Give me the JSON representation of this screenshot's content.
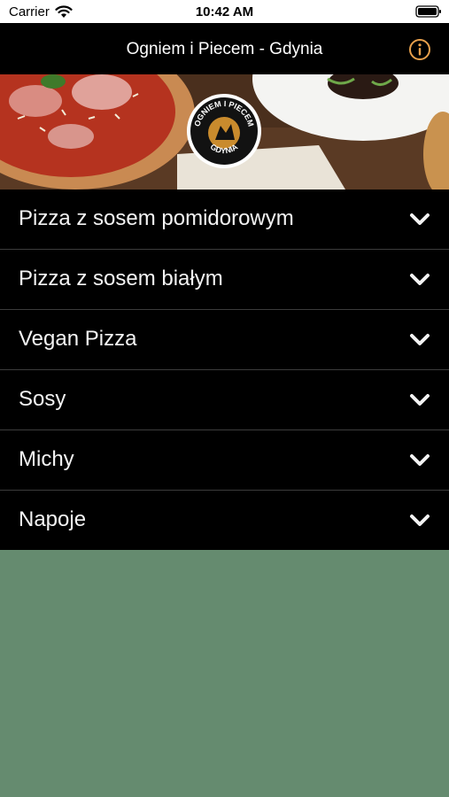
{
  "status_bar": {
    "carrier": "Carrier",
    "time": "10:42 AM",
    "icons": [
      "wifi-icon",
      "battery-icon"
    ]
  },
  "navbar": {
    "title": "Ogniem i Piecem - Gdynia",
    "info_icon": "info-icon",
    "accent_color": "#e8a04c"
  },
  "hero": {
    "logo_text_top": "OGNIEM I PIECEM",
    "logo_text_bottom": "GDYNIA"
  },
  "menu": {
    "items": [
      {
        "label": "Pizza z sosem pomidorowym",
        "icon": "chevron-down-icon"
      },
      {
        "label": "Pizza z sosem białym",
        "icon": "chevron-down-icon"
      },
      {
        "label": "Vegan Pizza",
        "icon": "chevron-down-icon"
      },
      {
        "label": "Sosy",
        "icon": "chevron-down-icon"
      },
      {
        "label": "Michy",
        "icon": "chevron-down-icon"
      },
      {
        "label": "Napoje",
        "icon": "chevron-down-icon"
      }
    ]
  },
  "colors": {
    "background": "#658b6f",
    "list_background": "#000000",
    "divider": "#3c3c3c"
  }
}
